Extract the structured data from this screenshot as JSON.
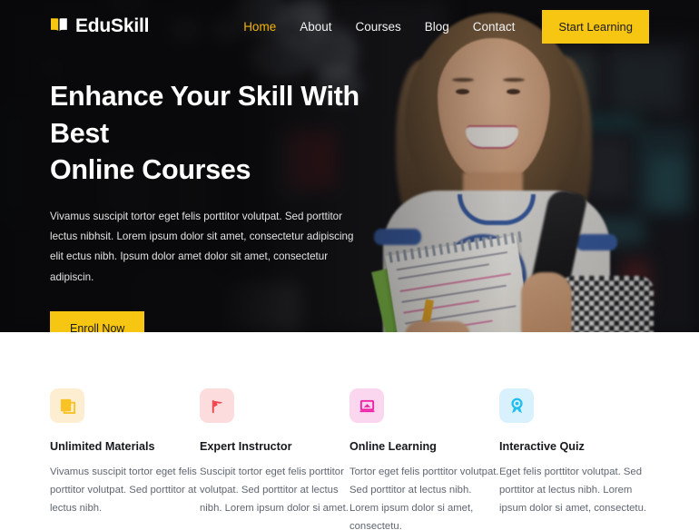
{
  "brand": {
    "name": "EduSkill",
    "logo_icon": "open-book-icon",
    "accent": "#f7c613"
  },
  "nav": {
    "links": [
      {
        "label": "Home",
        "active": true
      },
      {
        "label": "About",
        "active": false
      },
      {
        "label": "Courses",
        "active": false
      },
      {
        "label": "Blog",
        "active": false
      },
      {
        "label": "Contact",
        "active": false
      }
    ],
    "cta": "Start Learning"
  },
  "hero": {
    "title_line1": "Enhance Your Skill With Best",
    "title_line2": "Online Courses",
    "description": "Vivamus suscipit tortor eget felis porttitor volutpat. Sed porttitor lectus nibhsit. Lorem ipsum dolor sit amet, consectetur adipiscing elit ectus nibh. Ipsum dolor amet dolor sit amet, consectetur adipiscin.",
    "cta": "Enroll Now"
  },
  "features": [
    {
      "icon": "documents-icon",
      "icon_color": "#f9c325",
      "icon_bg": "#fdeed2",
      "title": "Unlimited Materials",
      "description": "Vivamus suscipit tortor eget felis porttitor volutpat. Sed porttitor at lectus nibh."
    },
    {
      "icon": "graduation-cap-flag-icon",
      "icon_color": "#f0434c",
      "icon_bg": "#fcdcdd",
      "title": "Expert Instructor",
      "description": "Suscipit tortor eget felis porttitor volutpat. Sed porttitor at lectus nibh. Lorem ipsum dolor si amet."
    },
    {
      "icon": "laptop-icon",
      "icon_color": "#ef23a5",
      "icon_bg": "#fbd7ef",
      "title": "Online Learning",
      "description": "Tortor eget felis porttitor volutpat. Sed porttitor at lectus nibh. Lorem ipsum dolor si amet, consectetu."
    },
    {
      "icon": "award-ribbon-icon",
      "icon_color": "#20bdf0",
      "icon_bg": "#d8f1fc",
      "title": "Interactive Quiz",
      "description": "Eget felis porttitor volutpat. Sed porttitor at lectus nibh. Lorem ipsum dolor si amet, consectetu."
    }
  ]
}
